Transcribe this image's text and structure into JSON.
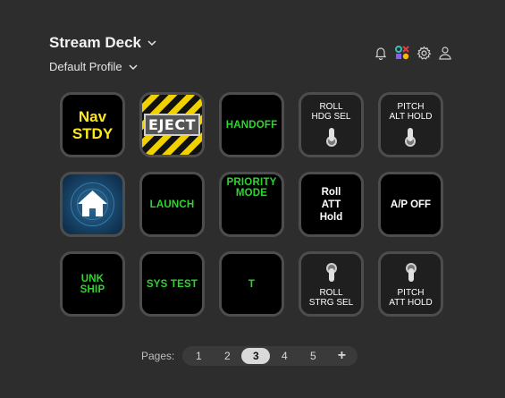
{
  "header": {
    "title": "Stream Deck",
    "profile": "Default Profile"
  },
  "top_icons": [
    "bell-icon",
    "marketplace-icon",
    "gear-icon",
    "user-icon"
  ],
  "keys": [
    {
      "label": "Nav\nSTDY",
      "style": "yellow"
    },
    {
      "label": "EJECT",
      "style": "hazard"
    },
    {
      "label": "HANDOFF",
      "style": "green"
    },
    {
      "label": "ROLL\nHDG SEL",
      "style": "toggle-top"
    },
    {
      "label": "PITCH\nALT HOLD",
      "style": "toggle-top"
    },
    {
      "label": "",
      "style": "home",
      "icon": "home-icon"
    },
    {
      "label": "LAUNCH",
      "style": "green"
    },
    {
      "label": "PRIORITY\nMODE",
      "style": "green"
    },
    {
      "label": "Roll\nATT\nHold",
      "style": "white"
    },
    {
      "label": "A/P OFF",
      "style": "white"
    },
    {
      "label": "UNK\nSHIP",
      "style": "green"
    },
    {
      "label": "SYS TEST",
      "style": "green"
    },
    {
      "label": "T",
      "style": "green"
    },
    {
      "label": "ROLL\nSTRG SEL",
      "style": "toggle-bottom"
    },
    {
      "label": "PITCH\nATT HOLD",
      "style": "toggle-bottom"
    }
  ],
  "pager": {
    "label": "Pages:",
    "pages": [
      "1",
      "2",
      "3",
      "4",
      "5"
    ],
    "current": "3",
    "add_label": "+"
  },
  "colors": {
    "background": "#2d2d2d",
    "key_border": "#4d4d4d",
    "green_text": "#2fd42f",
    "yellow_text": "#ffe81a",
    "hazard_yellow": "#f2d100"
  }
}
